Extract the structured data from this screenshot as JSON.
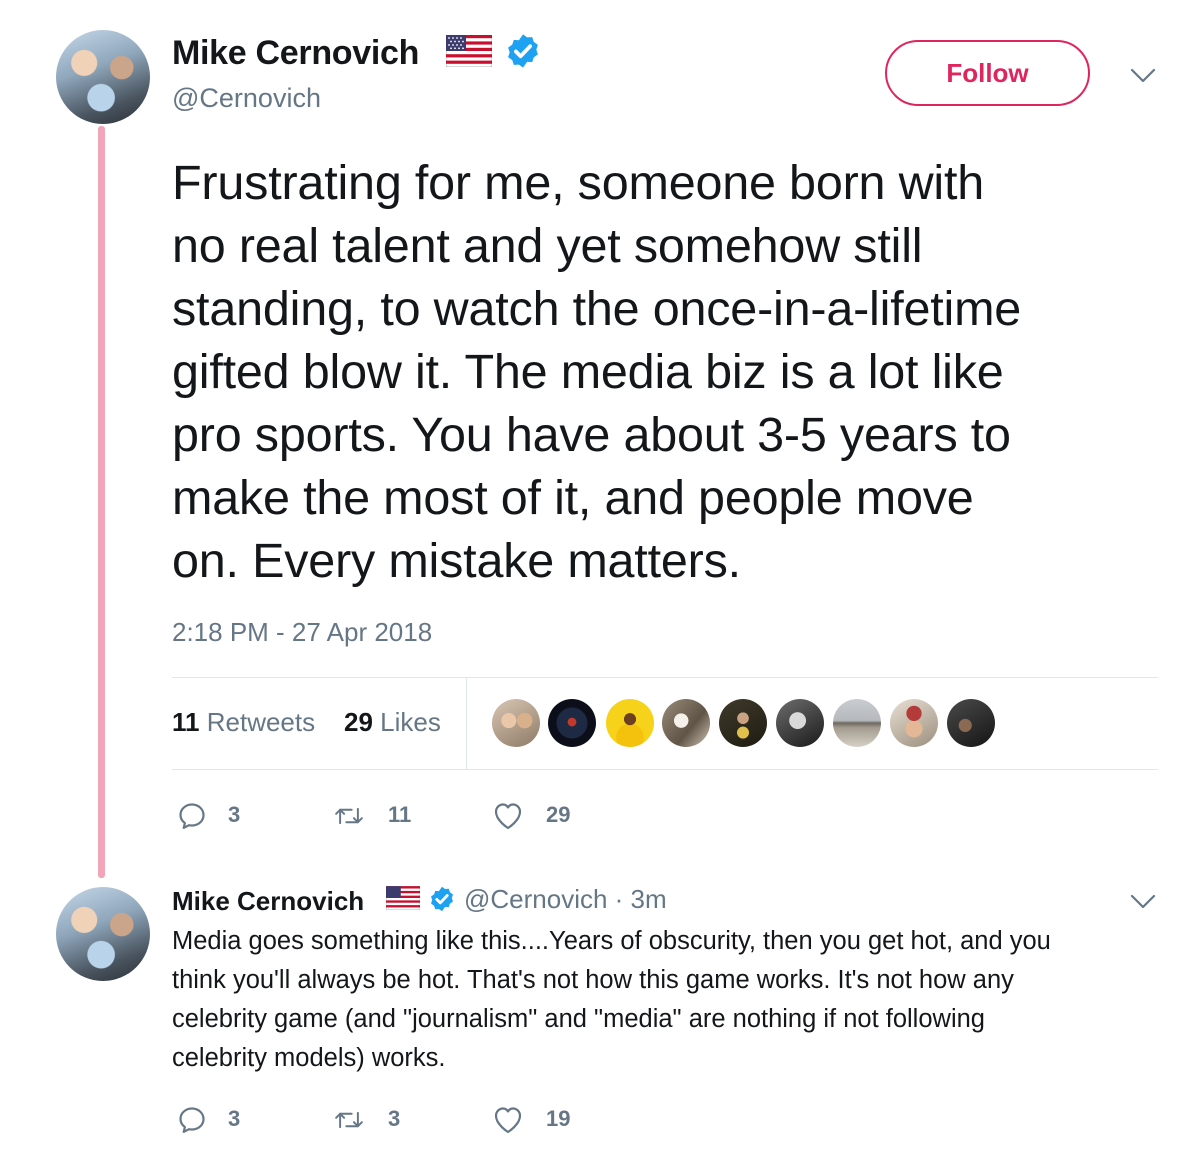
{
  "tweet": {
    "author": {
      "display_name": "Mike Cernovich",
      "handle": "@Cernovich",
      "flag": "us-flag-icon",
      "verified": true
    },
    "follow_label": "Follow",
    "text_lines": [
      "Frustrating for me, someone born with",
      "no real talent and yet somehow still",
      "standing, to watch the once-in-a-lifetime",
      "gifted blow it. The media biz is a lot like",
      "pro sports. You have about 3-5 years to",
      "make the most of it, and people move",
      "on. Every mistake matters."
    ],
    "timestamp": "2:18 PM - 27 Apr 2018",
    "stats": {
      "retweets_count": "11",
      "retweets_label": "Retweets",
      "likes_count": "29",
      "likes_label": "Likes"
    },
    "actions": {
      "replies": "3",
      "retweets": "11",
      "likes": "29"
    }
  },
  "reply": {
    "author": {
      "display_name": "Mike Cernovich",
      "handle": "@Cernovich",
      "time": "3m"
    },
    "meta": "@Cernovich · 3m",
    "text_lines": [
      "Media goes something like this....Years of obscurity, then you get hot, and you",
      "think you'll always be hot. That's not how this game works. It's not how any",
      "celebrity game (and \"journalism\" and \"media\" are nothing if not following",
      "celebrity models) works."
    ],
    "actions": {
      "replies": "3",
      "retweets": "3",
      "likes": "19"
    }
  },
  "colors": {
    "follow_accent": "#e0245e",
    "thread_line": "#f2a5b9",
    "verified_blue": "#1da1f2",
    "secondary_text": "#657786",
    "border": "#e1e8ed"
  }
}
